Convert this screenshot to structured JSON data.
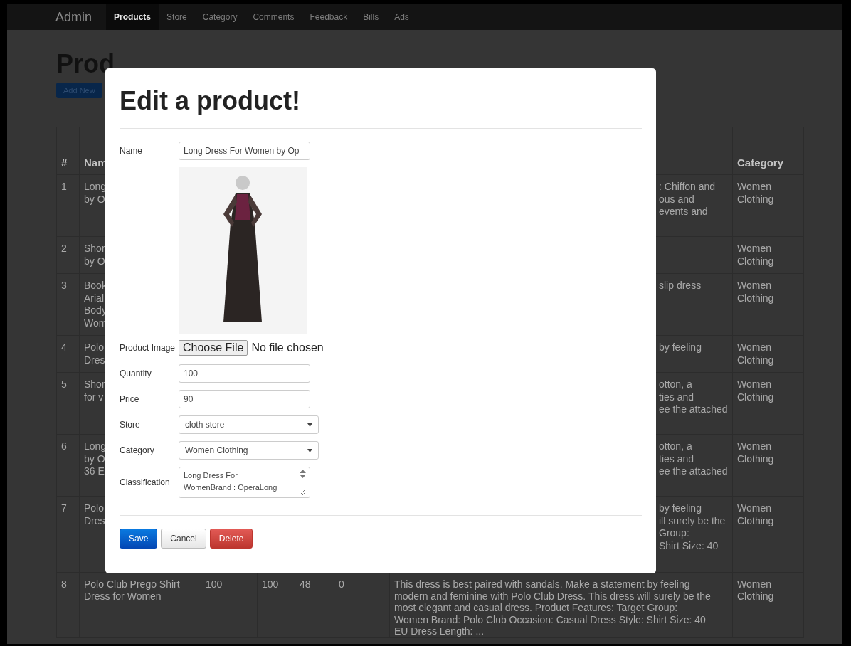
{
  "navbar": {
    "brand": "Admin",
    "items": [
      {
        "label": "Products",
        "selected": true
      },
      {
        "label": "Store",
        "selected": false
      },
      {
        "label": "Category",
        "selected": false
      },
      {
        "label": "Comments",
        "selected": false
      },
      {
        "label": "Feedback",
        "selected": false
      },
      {
        "label": "Bills",
        "selected": false
      },
      {
        "label": "Ads",
        "selected": false
      }
    ]
  },
  "page": {
    "title": "Prod",
    "add_button": "Add New"
  },
  "table": {
    "number_column": "#",
    "name_column": "Nam",
    "category_column": "Category",
    "rows": [
      {
        "number": "1",
        "name_lines": [
          "Long",
          "by O"
        ],
        "description_lines": [
          ": Chiffon and",
          "ous and",
          "events and"
        ],
        "category_lines": [
          "Women",
          "Clothing"
        ]
      },
      {
        "number": "2",
        "name_lines": [
          "Shor",
          "by O"
        ],
        "category_lines": [
          "Women",
          "Clothing"
        ]
      },
      {
        "number": "3",
        "name_lines": [
          "Book",
          "Arial",
          "Body",
          "Wom"
        ],
        "description_lines": [
          "slip dress"
        ],
        "category_lines": [
          "Women",
          "Clothing"
        ]
      },
      {
        "number": "4",
        "name_lines": [
          "Polo",
          "Dres"
        ],
        "description_lines": [
          "by feeling"
        ],
        "category_lines": [
          "Women",
          "Clothing"
        ]
      },
      {
        "number": "5",
        "name_lines": [
          "Shor",
          "for v"
        ],
        "description_lines": [
          "otton, a",
          "ties and",
          "ee the attached"
        ],
        "category_lines": [
          "Women",
          "Clothing"
        ]
      },
      {
        "number": "6",
        "name_lines": [
          "Long",
          "by O",
          "36 E"
        ],
        "description_lines": [
          "otton, a",
          "ties and",
          "ee the attached"
        ],
        "category_lines": [
          "Women",
          "Clothing"
        ]
      },
      {
        "number": "7",
        "name_lines": [
          "Polo",
          "Dres"
        ],
        "description_lines": [
          "by feeling",
          "ill surely be the",
          "Group:",
          "Shirt Size: 40"
        ],
        "category_lines": [
          "Women",
          "Clothing"
        ]
      },
      {
        "number": "8",
        "name_lines": [
          "Polo Club Prego Shirt",
          "Dress for Women"
        ],
        "values": [
          "100",
          "100",
          "48",
          "0"
        ],
        "description_lines": [
          "This dress is best paired with sandals. Make a statement by feeling",
          "modern and feminine with Polo Club Dress. This dress will surely be the",
          "most elegant and casual dress. Product Features: Target Group:",
          "Women Brand: Polo Club Occasion: Casual Dress Style: Shirt Size: 40",
          "EU Dress Length: ..."
        ],
        "category_lines": [
          "Women",
          "Clothing"
        ]
      }
    ]
  },
  "modal": {
    "title": "Edit a product!",
    "fields": [
      {
        "kind": "text",
        "label": "Name",
        "value": "Long Dress For Women by Op"
      },
      {
        "kind": "image"
      },
      {
        "kind": "file",
        "label": "Product Image",
        "button": "Choose File",
        "status": "No file chosen"
      },
      {
        "kind": "text",
        "label": "Quantity",
        "value": "100"
      },
      {
        "kind": "text",
        "label": "Price",
        "value": "90"
      },
      {
        "kind": "select",
        "label": "Store",
        "value": "cloth store"
      },
      {
        "kind": "select",
        "label": "Category",
        "value": "Women Clothing"
      },
      {
        "kind": "textarea",
        "label": "Classification",
        "lines": [
          "Long Dress For",
          "WomenBrand : OperaLong"
        ]
      }
    ],
    "buttons": [
      {
        "label": "Save",
        "kind": "primary"
      },
      {
        "label": "Cancel",
        "kind": "default"
      },
      {
        "label": "Delete",
        "kind": "danger"
      }
    ]
  }
}
